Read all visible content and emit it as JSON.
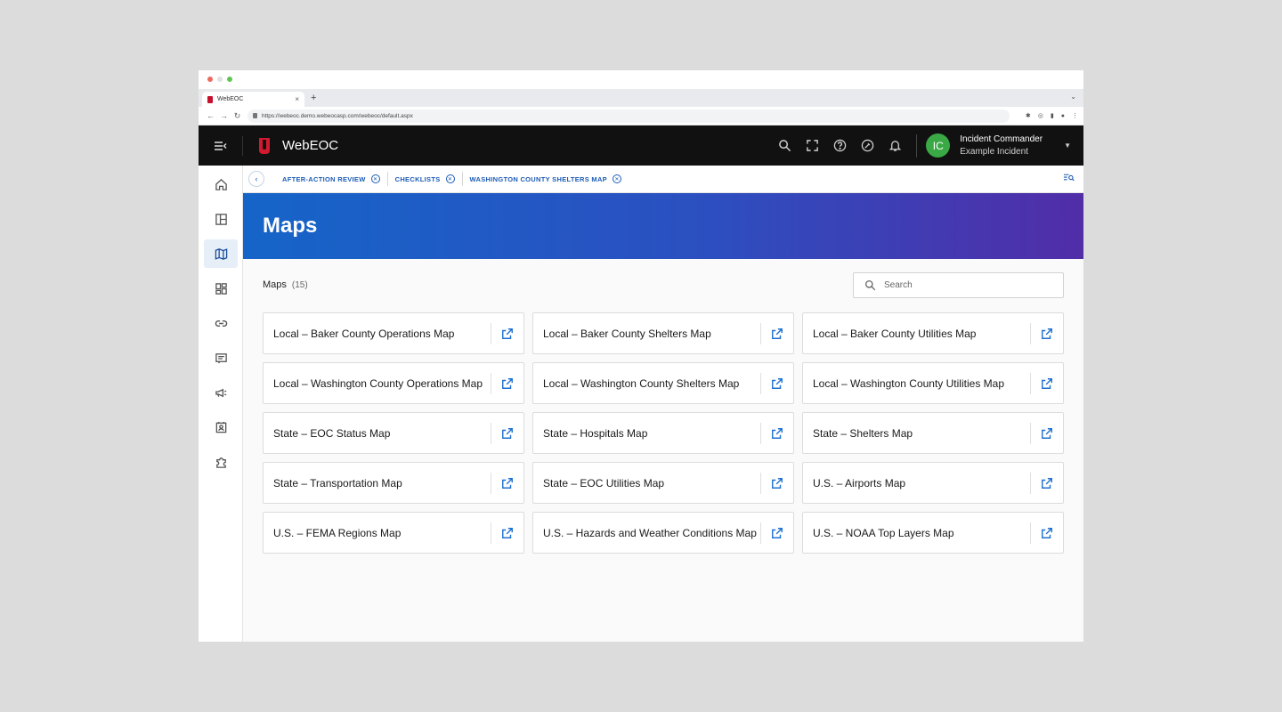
{
  "browser": {
    "tab_title": "WebEOC",
    "tab_close": "×",
    "new_tab": "+",
    "url": "https://webeoc.demo.webeocasp.com/webeoc/default.aspx"
  },
  "app": {
    "name": "WebEOC",
    "user": {
      "initials": "IC",
      "name": "Incident Commander",
      "incident": "Example Incident"
    }
  },
  "nav_items": [
    {
      "icon": "home-icon",
      "active": false
    },
    {
      "icon": "boards-icon",
      "active": false
    },
    {
      "icon": "map-icon",
      "active": true
    },
    {
      "icon": "dashboard-icon",
      "active": false
    },
    {
      "icon": "link-icon",
      "active": false
    },
    {
      "icon": "message-icon",
      "active": false
    },
    {
      "icon": "megaphone-icon",
      "active": false
    },
    {
      "icon": "contacts-icon",
      "active": false
    },
    {
      "icon": "plugin-icon",
      "active": false
    }
  ],
  "open_tabs": [
    {
      "label": "AFTER-ACTION REVIEW"
    },
    {
      "label": "CHECKLISTS"
    },
    {
      "label": "WASHINGTON COUNTY SHELTERS MAP"
    }
  ],
  "page": {
    "title": "Maps",
    "list_title": "Maps",
    "count": "(15)",
    "search_placeholder": "Search"
  },
  "maps": [
    "Local – Baker County Operations Map",
    "Local – Baker County Shelters Map",
    "Local – Baker County Utilities Map",
    "Local – Washington County Operations Map",
    "Local – Washington County Shelters Map",
    "Local – Washington County Utilities Map",
    "State – EOC Status Map",
    "State – Hospitals Map",
    "State – Shelters Map",
    "State – Transportation Map",
    "State – EOC Utilities Map",
    "U.S. – Airports Map",
    "U.S. – FEMA Regions Map",
    "U.S. – Hazards and Weather Conditions Map",
    "U.S. – NOAA Top Layers Map"
  ],
  "colors": {
    "accent": "#1b5bb5",
    "header_bg": "#111111",
    "hero_start": "#1565c8",
    "hero_end": "#512da8",
    "avatar": "#3aa845",
    "brand_red": "#d2192d"
  }
}
